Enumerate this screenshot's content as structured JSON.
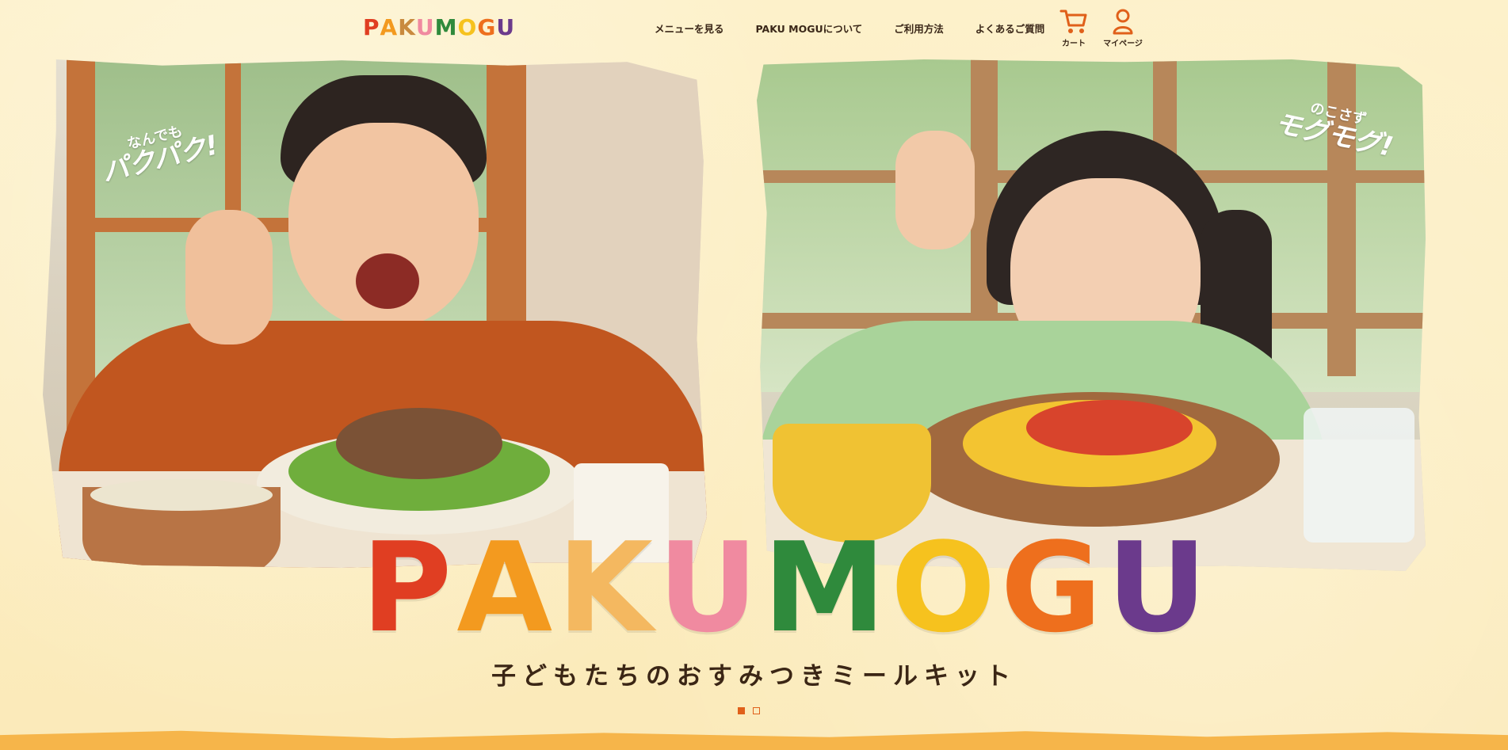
{
  "brand": {
    "letters": [
      "P",
      "A",
      "K",
      "U",
      "M",
      "O",
      "G",
      "U"
    ],
    "letter_colors": [
      "#e03e22",
      "#f39a1f",
      "#f4b860",
      "#f08aa0",
      "#2f8a3c",
      "#f6c21e",
      "#ee6f1d",
      "#6b3a8c"
    ]
  },
  "nav": {
    "items": [
      {
        "label": "メニューを見る"
      },
      {
        "label": "PAKU MOGUについて"
      },
      {
        "label": "ご利用方法"
      },
      {
        "label": "よくあるご質問"
      }
    ],
    "cart_label": "カート",
    "mypage_label": "マイページ"
  },
  "hero": {
    "left_caption_small": "なんでも",
    "left_caption_big": "パクパク!",
    "right_caption_small": "のこさず",
    "right_caption_big": "モグモグ!",
    "tagline": "子どもたちのおすみつきミールキット"
  },
  "slider": {
    "current": 1,
    "total": 2
  },
  "colors": {
    "background": "#fcefc5",
    "accent": "#e0601a"
  }
}
